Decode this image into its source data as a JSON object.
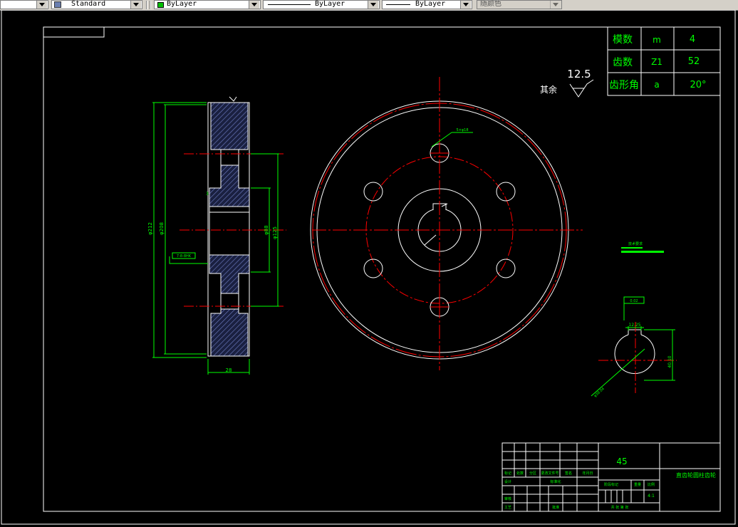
{
  "toolbar": {
    "textstyle": "Standard",
    "layer_color": "ByLayer",
    "linetype": "ByLayer",
    "lineweight": "ByLayer",
    "plotstyle": "随颜色",
    "swatch_color": "#00c000"
  },
  "colors": {
    "frame": "#ffffff",
    "geometry": "#ffffff",
    "centerline": "#ff0000",
    "dimension": "#00ff00",
    "hatch": "#4a5aa8",
    "text": "#00ff00"
  },
  "param_table": {
    "rows": [
      {
        "name": "模数",
        "symbol": "m",
        "value": "4"
      },
      {
        "name": "齿数",
        "symbol": "Z1",
        "value": "52"
      },
      {
        "name": "齿形角",
        "symbol": "a",
        "value": "20°"
      }
    ]
  },
  "roughness": {
    "value": "12.5",
    "label": "其余"
  },
  "side_view_dims": {
    "d_tip": "φ212",
    "d_root": "φ208",
    "d_hub": "φ88",
    "d_hole_circle": "φ125",
    "width": "28",
    "note": "7-8-8HK",
    "chamfer": "3"
  },
  "front_view": {
    "hole_label": "5×φ18"
  },
  "keyway_view": {
    "tolerance_frame": "0.02",
    "key_width": "12.25",
    "key_depth": "40.10",
    "bore": "φ38.04"
  },
  "title_block": {
    "material": "45",
    "part_name": "直齿轮圆柱齿轮",
    "scale": "4:1",
    "labels_row": [
      "标记",
      "处数",
      "分区",
      "更改文件号",
      "签名",
      "年月日"
    ],
    "design_label": "设计",
    "standard_label": "标准化",
    "review_label": "审核",
    "process_label": "工艺",
    "approve_label": "批准",
    "stage_label": "阶段标记",
    "weight_label": "重量",
    "ratio_label": "比例",
    "sheet_label": "共 张 第 张"
  },
  "small_note": {
    "label": "技术要求"
  }
}
